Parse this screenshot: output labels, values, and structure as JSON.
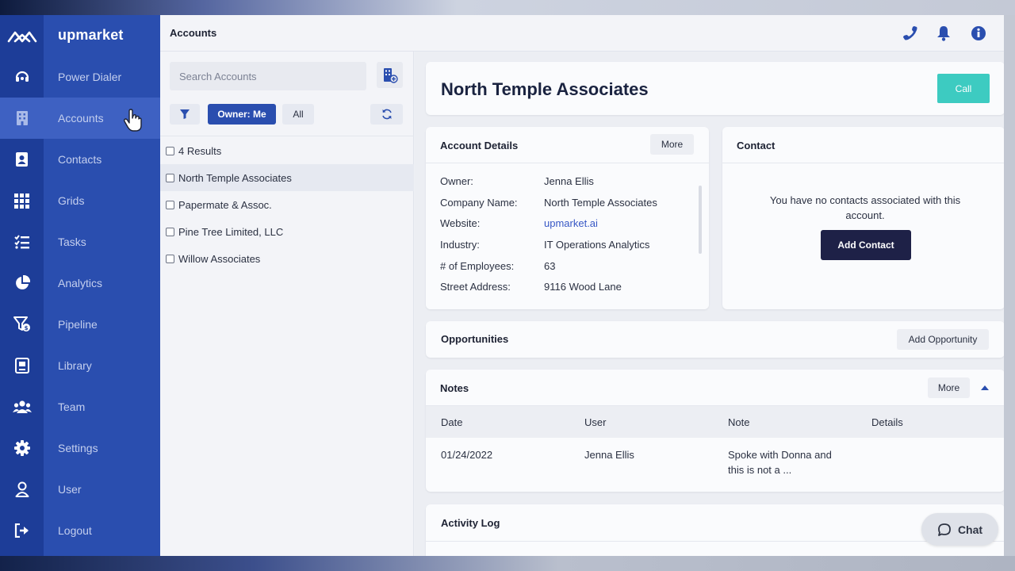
{
  "brand": {
    "name": "upmarket"
  },
  "sidebar": {
    "items": [
      {
        "label": "Power Dialer"
      },
      {
        "label": "Accounts"
      },
      {
        "label": "Contacts"
      },
      {
        "label": "Grids"
      },
      {
        "label": "Tasks"
      },
      {
        "label": "Analytics"
      },
      {
        "label": "Pipeline"
      },
      {
        "label": "Library"
      },
      {
        "label": "Team"
      },
      {
        "label": "Settings"
      },
      {
        "label": "User"
      },
      {
        "label": "Logout"
      }
    ]
  },
  "topbar": {
    "title": "Accounts"
  },
  "accounts_list": {
    "search_placeholder": "Search Accounts",
    "filter_owner": "Owner: Me",
    "filter_all": "All",
    "results_label": "4 Results",
    "rows": [
      {
        "name": "North Temple Associates"
      },
      {
        "name": "Papermate & Assoc."
      },
      {
        "name": "Pine Tree Limited, LLC"
      },
      {
        "name": "Willow Associates"
      }
    ]
  },
  "account": {
    "name": "North Temple Associates",
    "call_label": "Call"
  },
  "account_details": {
    "title": "Account Details",
    "more_label": "More",
    "fields": [
      {
        "label": "Owner:",
        "value": "Jenna Ellis"
      },
      {
        "label": "Company Name:",
        "value": "North Temple Associates"
      },
      {
        "label": "Website:",
        "value": "upmarket.ai"
      },
      {
        "label": "Industry:",
        "value": "IT Operations Analytics"
      },
      {
        "label": "# of Employees:",
        "value": "63"
      },
      {
        "label": "Street Address:",
        "value": "9116 Wood Lane"
      }
    ]
  },
  "contact": {
    "title": "Contact",
    "empty_message": "You have no contacts associated with this account.",
    "add_label": "Add Contact"
  },
  "opportunities": {
    "title": "Opportunities",
    "add_label": "Add Opportunity"
  },
  "notes": {
    "title": "Notes",
    "more_label": "More",
    "columns": [
      "Date",
      "User",
      "Note",
      "Details"
    ],
    "rows": [
      {
        "date": "01/24/2022",
        "user": "Jenna Ellis",
        "note": "Spoke with Donna and this is not a ...",
        "details": ""
      }
    ]
  },
  "activity_log": {
    "title": "Activity Log"
  },
  "chat": {
    "label": "Chat"
  },
  "colors": {
    "rail": "#1d3d98",
    "nav": "#2a4eaf",
    "accent": "#2a4eaf",
    "call": "#3dcbc1",
    "primary_dark": "#1e2147"
  }
}
